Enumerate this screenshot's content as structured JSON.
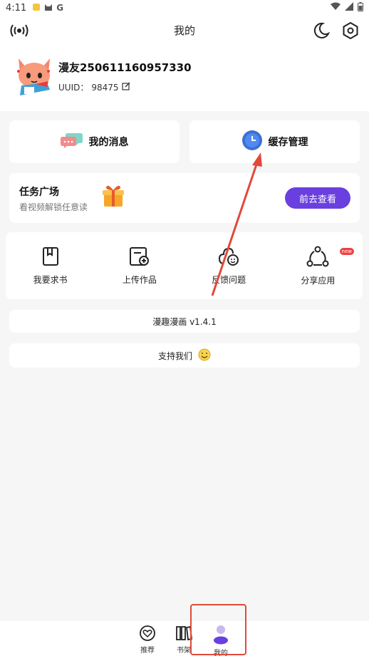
{
  "status_bar": {
    "time": "4:11",
    "right_icons": [
      "wifi-icon",
      "signal-icon",
      "battery-icon"
    ]
  },
  "header": {
    "title": "我的"
  },
  "profile": {
    "username": "漫友250611160957330",
    "uuid_label": "UUID：",
    "uuid_value": "98475"
  },
  "cards": {
    "messages_label": "我的消息",
    "cache_label": "缓存管理"
  },
  "task": {
    "title": "任务广场",
    "subtitle": "看视频解锁任意读",
    "button": "前去查看"
  },
  "grid": [
    {
      "label": "我要求书",
      "icon": "book-icon"
    },
    {
      "label": "上传作品",
      "icon": "upload-icon"
    },
    {
      "label": "反馈问题",
      "icon": "feedback-icon"
    },
    {
      "label": "分享应用",
      "icon": "share-icon",
      "badge": "new"
    }
  ],
  "version": "漫趣漫画 v1.4.1",
  "support": "支持我们",
  "bottom_nav": [
    {
      "label": "推荐",
      "icon": "heart-icon"
    },
    {
      "label": "书架",
      "icon": "bookshelf-icon"
    },
    {
      "label": "我的",
      "icon": "person-icon",
      "active": true
    }
  ],
  "colors": {
    "accent": "#6a3fe0",
    "annotation": "#e04a3a"
  }
}
